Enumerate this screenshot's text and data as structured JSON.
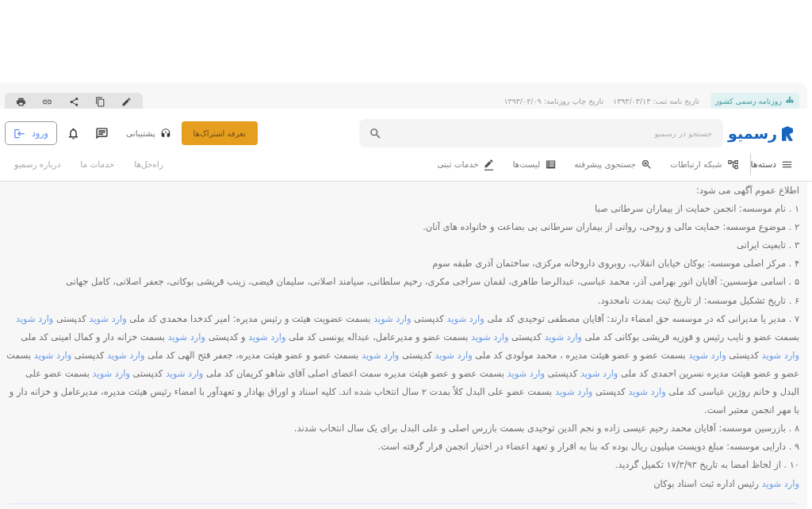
{
  "gazette": {
    "badge": "روزنامه رسمی کشور",
    "registration_date": "تاریخ نامه ثبت: ۱۳۹۳/۰۳/۱۳",
    "print_date": "تاریخ چاپ روزنامه: ۱۳۹۳/۰۴/۰۹"
  },
  "header": {
    "logo": "رسمیو",
    "search": {
      "placeholder": "جستجو در رسمیو"
    },
    "plans_button": "تعرفه اشتراک‌ها",
    "support": "پشتیبانی",
    "login_button": "ورود"
  },
  "nav": {
    "main": [
      "دسته‌ها",
      "شبکه ارتباطات",
      "جستجوی پیشرفته",
      "لیست‌ها",
      "خدمات ثبتی"
    ],
    "secondary": [
      "راه‌حل‌ها",
      "خدمات ما",
      "درباره رسمیو"
    ]
  },
  "notice": {
    "paragraphs": [
      {
        "segments": [
          {
            "kind": "text",
            "text": "اطلاع عموم آگهی می شود:"
          }
        ]
      },
      {
        "segments": [
          {
            "kind": "text",
            "text": "۱ . نام موسسه: انجمن حمایت از بیماران سرطانی صبا"
          }
        ]
      },
      {
        "segments": [
          {
            "kind": "text",
            "text": "۲ . موضوع موسسه: حمایت مالی و روحی، روانی از بیماران سرطانی بی بضاعت و خانواده های آنان."
          }
        ]
      },
      {
        "segments": [
          {
            "kind": "text",
            "text": "۳ . تابعیت ایرانی"
          }
        ]
      },
      {
        "segments": [
          {
            "kind": "text",
            "text": "۴ . مرکز اصلی موسسه: بوکان خیابان انقلاب، روبروی داروخانه مرکزی، ساختمان آذری طبقه سوم"
          }
        ]
      },
      {
        "segments": [
          {
            "kind": "text",
            "text": "۵ . اسامی مؤسسین: آقایان انور بهرامی آذر، محمد عباسی، عبدالرضا طاهری، لقمان سراجی مکری، رحیم سلطانی، سیامند اصلانی، سلیمان فیضی، زینب قریشی بوکانی، جعفر اصلانی، کامل جهانی"
          }
        ]
      },
      {
        "segments": [
          {
            "kind": "text",
            "text": "۶ . تاریخ تشکیل موسسه: از تاریخ ثبت بمدت نامحدود."
          }
        ]
      },
      {
        "segments": [
          {
            "kind": "text",
            "text": "۷ . مدیر یا مدیرانی که در موسسه حق امضاء دارند: آقایان مصطفی توحیدی کد ملی "
          },
          {
            "kind": "link",
            "text": "وارد شوید"
          },
          {
            "kind": "text",
            "text": " کدپستی "
          },
          {
            "kind": "link",
            "text": "وارد شوید"
          },
          {
            "kind": "text",
            "text": " بسمت عضویت هیئت و رئیس مدیره: امیر کدخدا محمدی کد ملی "
          },
          {
            "kind": "link",
            "text": "وارد شوید"
          },
          {
            "kind": "text",
            "text": " کدپستی "
          },
          {
            "kind": "link",
            "text": "وارد شوید"
          },
          {
            "kind": "text",
            "text": " بسمت عضو و نایب رئیس و فوزیه قریشی بوکانی کد ملی "
          },
          {
            "kind": "link",
            "text": "وارد شوید"
          },
          {
            "kind": "text",
            "text": " کدپستی "
          },
          {
            "kind": "link",
            "text": "وارد شوید"
          },
          {
            "kind": "text",
            "text": " بسمت عضو و مدیرعامل، عبداله یونسی کد ملی "
          },
          {
            "kind": "link",
            "text": "وارد شوید"
          },
          {
            "kind": "text",
            "text": " و کدپستی "
          },
          {
            "kind": "link",
            "text": "وارد شوید"
          },
          {
            "kind": "text",
            "text": " بسمت خزانه دار و کمال امینی کد ملی "
          },
          {
            "kind": "link",
            "text": "وارد شوید"
          },
          {
            "kind": "text",
            "text": " کدپستی "
          },
          {
            "kind": "link",
            "text": "وارد شوید"
          },
          {
            "kind": "text",
            "text": " بسمت عضو و عضو هیئت مدیره ، محمد مولودی کد ملی "
          },
          {
            "kind": "link",
            "text": "وارد شوید"
          },
          {
            "kind": "text",
            "text": " کدپستی "
          },
          {
            "kind": "link",
            "text": "وارد شوید"
          },
          {
            "kind": "text",
            "text": " بسمت عضو و عضو هیئت مدیره، جعفر فتح الهی کد ملی "
          },
          {
            "kind": "link",
            "text": "وارد شوید"
          },
          {
            "kind": "text",
            "text": " کدپستی "
          },
          {
            "kind": "link",
            "text": "وارد شوید"
          },
          {
            "kind": "text",
            "text": " بسمت عضو و عضو هیئت مدیره نسرین احمدی کد ملی "
          },
          {
            "kind": "link",
            "text": "وارد شوید"
          },
          {
            "kind": "text",
            "text": " کدپستی "
          },
          {
            "kind": "link",
            "text": "وارد شوید"
          },
          {
            "kind": "text",
            "text": " بسمت عضو و عضو هیئت مدیره سمت اعضای اصلی آقای شاهو کریمان کد ملی "
          },
          {
            "kind": "link",
            "text": "وارد شوید"
          },
          {
            "kind": "text",
            "text": " کدپستی "
          },
          {
            "kind": "link",
            "text": "وارد شوید"
          },
          {
            "kind": "text",
            "text": " بسمت عضو علی البدل و خانم روژین عباسی کد ملی "
          },
          {
            "kind": "link",
            "text": "وارد شوید"
          },
          {
            "kind": "text",
            "text": " کدپستی "
          },
          {
            "kind": "link",
            "text": "وارد شوید"
          },
          {
            "kind": "text",
            "text": " بسمت عضو علی البدل کلاً بمدت ۲ سال انتخاب شده اند. کلیه اسناد و اوراق بهادار و تعهدآور با امضاء رئیس هیئت مدیره، مدیرعامل و خزانه دار و با مهر انجمن معتبر است."
          }
        ]
      },
      {
        "segments": [
          {
            "kind": "text",
            "text": "۸ . بازرسین موسسه: آقایان محمد رحیم عیسی زاده و نجم الدین توحیدی بسمت بازرس اصلی و علی البدل برای یک سال انتخاب شدند."
          }
        ]
      },
      {
        "segments": [
          {
            "kind": "text",
            "text": "۹ . دارایی موسسه: مبلغ دویست میلیون ریال بوده که بنا به اقرار و تعهد اعضاء در اختیار انجمن قرار گرفته است."
          }
        ]
      },
      {
        "segments": [
          {
            "kind": "text",
            "text": "۱۰ . از لحاظ امضا به تاریخ ۱۷/۳/۹۳ تکمیل گردید."
          }
        ]
      },
      {
        "segments": [
          {
            "kind": "link",
            "text": "وارد شوید"
          },
          {
            "kind": "text",
            "text": " رئیس اداره ثبت اسناد بوکان"
          }
        ]
      }
    ]
  }
}
